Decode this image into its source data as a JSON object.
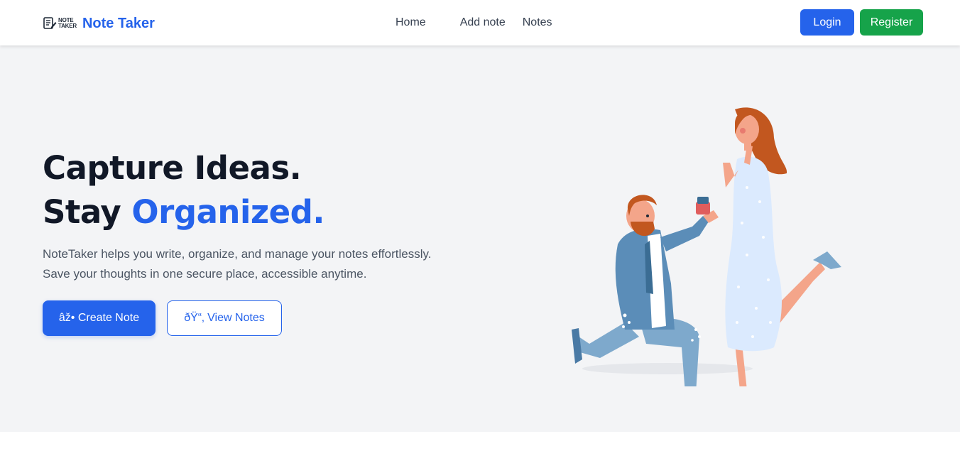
{
  "brand": {
    "logo_line1": "NOTE",
    "logo_line2": "TAKER",
    "name": "Note Taker",
    "logo_icon": "note-pencil-icon"
  },
  "nav": {
    "home": "Home",
    "add_note": "Add note",
    "notes": "Notes"
  },
  "auth": {
    "login": "Login",
    "register": "Register"
  },
  "hero": {
    "headline_line1": "Capture Ideas.",
    "headline_line2_prefix": "Stay ",
    "headline_line2_accent": "Organized.",
    "description_line1": "NoteTaker helps you write, organize, and manage your notes effortlessly.",
    "description_line2": "Save your thoughts in one secure place, accessible anytime.",
    "create_button": "âž• Create Note",
    "view_button": "ðŸ“‚ View Notes",
    "illustration": "proposal-illustration"
  },
  "colors": {
    "primary": "#2563eb",
    "success": "#16a34a",
    "hero_bg": "#f3f4f6",
    "heading": "#111827",
    "body_text": "#4b5563"
  }
}
